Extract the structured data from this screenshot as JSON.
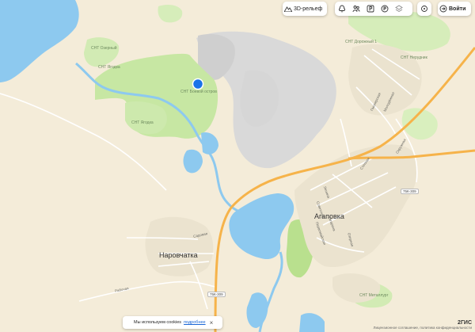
{
  "toolbar": {
    "relief_label": "3D-рельеф",
    "login_label": "Войти"
  },
  "places": {
    "agapovka": "Агаповка",
    "narovchatka": "Наровчатка"
  },
  "snt": {
    "ozernyy": "СНТ Озерный",
    "yagodka": "СНТ Ягодка",
    "boevoy_ostrov": "СНТ Боевой остров",
    "yagodka2": "СНТ Ягодка",
    "dorozhnik": "СНТ Дорожный 1",
    "nerudnik": "СНТ Нерудник",
    "metallurg": "СНТ Металлург"
  },
  "streets": {
    "sadovaya": "Садовая",
    "rabochaya": "Рабочая",
    "okruzhnaya": "Окружная",
    "stepnaya": "Степная",
    "molodezhnaya": "Молодёжная",
    "pionerskaya": "Пионерская",
    "lenina": "Ленина",
    "sovetskaya": "Советская",
    "gagarina": "Гагарина",
    "pervomayskaya": "Первомайская",
    "ozernaya": "Озерная"
  },
  "roads": {
    "r1": "75К-309",
    "r2": "75К-309"
  },
  "cookie": {
    "text": "Мы используем cookies",
    "link": "подробнее",
    "close": "×"
  },
  "footer": {
    "brand": "2ГИС",
    "legal": "Лицензионное соглашение, политика конфиденциальности"
  },
  "colors": {
    "land": "#f4ecd9",
    "water": "#8cc8f0",
    "forest": "#c6e6a0",
    "quarry": "#d4d4d4",
    "road_major": "#f5b041",
    "road_minor": "#ffffff",
    "marker": "#1a73e8"
  }
}
